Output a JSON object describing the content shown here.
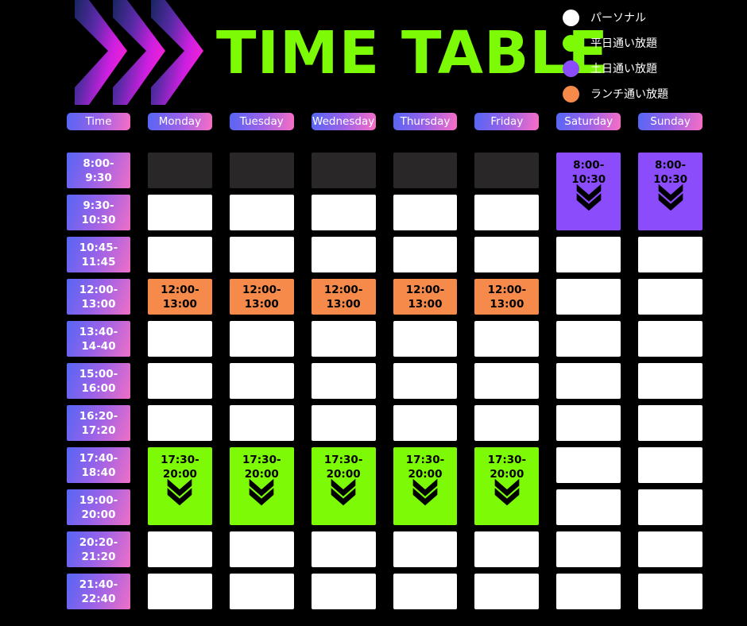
{
  "page": {
    "title": "TIME TABLE",
    "background_color": "#000000",
    "title_color": "#7DFB06"
  },
  "logo": {
    "icon": "triple-chevron-right-icon",
    "gradient_from": "#1b2a6e",
    "gradient_to": "#e81ee8"
  },
  "legend": {
    "items": [
      {
        "label": "パーソナル",
        "color": "#FFFFFF",
        "icon": "legend-dot-icon"
      },
      {
        "label": "平日通い放題",
        "color": "#7DFB06",
        "icon": "legend-dot-icon"
      },
      {
        "label": "土日通い放題",
        "color": "#8B4DFB",
        "icon": "legend-dot-icon"
      },
      {
        "label": "ランチ通い放題",
        "color": "#F58A4B",
        "icon": "legend-dot-icon"
      }
    ]
  },
  "table": {
    "headers": [
      "Time",
      "Monday",
      "Tuesday",
      "Wednesday",
      "Thursday",
      "Friday",
      "Saturday",
      "Sunday"
    ],
    "time_slots": [
      "8:00-\n9:30",
      "9:30-\n10:30",
      "10:45-\n11:45",
      "12:00-\n13:00",
      "13:40-\n14-40",
      "15:00-\n16:00",
      "16:20-\n17:20",
      "17:40-\n18:40",
      "19:00-\n20:00",
      "20:20-\n21:20",
      "21:40-\n22:40"
    ],
    "rows": [
      {
        "time": "8:00-\n9:30",
        "cells": [
          {
            "type": "dark",
            "text": ""
          },
          {
            "type": "dark",
            "text": ""
          },
          {
            "type": "dark",
            "text": ""
          },
          {
            "type": "dark",
            "text": ""
          },
          {
            "type": "dark",
            "text": ""
          },
          {
            "type": "purple",
            "text": "8:00-\n10:30",
            "span": "top"
          },
          {
            "type": "purple",
            "text": "8:00-\n10:30",
            "span": "top"
          }
        ]
      },
      {
        "time": "9:30-\n10:30",
        "cells": [
          {
            "type": "white",
            "text": ""
          },
          {
            "type": "white",
            "text": ""
          },
          {
            "type": "white",
            "text": ""
          },
          {
            "type": "white",
            "text": ""
          },
          {
            "type": "white",
            "text": ""
          },
          {
            "type": "purple",
            "text": "",
            "span": "bottom",
            "arrow": true
          },
          {
            "type": "purple",
            "text": "",
            "span": "bottom",
            "arrow": true
          }
        ]
      },
      {
        "time": "10:45-\n11:45",
        "cells": [
          {
            "type": "white",
            "text": ""
          },
          {
            "type": "white",
            "text": ""
          },
          {
            "type": "white",
            "text": ""
          },
          {
            "type": "white",
            "text": ""
          },
          {
            "type": "white",
            "text": ""
          },
          {
            "type": "white",
            "text": ""
          },
          {
            "type": "white",
            "text": ""
          }
        ]
      },
      {
        "time": "12:00-\n13:00",
        "cells": [
          {
            "type": "orange",
            "text": "12:00-\n13:00"
          },
          {
            "type": "orange",
            "text": "12:00-\n13:00"
          },
          {
            "type": "orange",
            "text": "12:00-\n13:00"
          },
          {
            "type": "orange",
            "text": "12:00-\n13:00"
          },
          {
            "type": "orange",
            "text": "12:00-\n13:00"
          },
          {
            "type": "white",
            "text": ""
          },
          {
            "type": "white",
            "text": ""
          }
        ]
      },
      {
        "time": "13:40-\n14-40",
        "cells": [
          {
            "type": "white",
            "text": ""
          },
          {
            "type": "white",
            "text": ""
          },
          {
            "type": "white",
            "text": ""
          },
          {
            "type": "white",
            "text": ""
          },
          {
            "type": "white",
            "text": ""
          },
          {
            "type": "white",
            "text": ""
          },
          {
            "type": "white",
            "text": ""
          }
        ]
      },
      {
        "time": "15:00-\n16:00",
        "cells": [
          {
            "type": "white",
            "text": ""
          },
          {
            "type": "white",
            "text": ""
          },
          {
            "type": "white",
            "text": ""
          },
          {
            "type": "white",
            "text": ""
          },
          {
            "type": "white",
            "text": ""
          },
          {
            "type": "white",
            "text": ""
          },
          {
            "type": "white",
            "text": ""
          }
        ]
      },
      {
        "time": "16:20-\n17:20",
        "cells": [
          {
            "type": "white",
            "text": ""
          },
          {
            "type": "white",
            "text": ""
          },
          {
            "type": "white",
            "text": ""
          },
          {
            "type": "white",
            "text": ""
          },
          {
            "type": "white",
            "text": ""
          },
          {
            "type": "white",
            "text": ""
          },
          {
            "type": "white",
            "text": ""
          }
        ]
      },
      {
        "time": "17:40-\n18:40",
        "cells": [
          {
            "type": "green",
            "text": "17:30-\n20:00",
            "span": "top"
          },
          {
            "type": "green",
            "text": "17:30-\n20:00",
            "span": "top"
          },
          {
            "type": "green",
            "text": "17:30-\n20:00",
            "span": "top"
          },
          {
            "type": "green",
            "text": "17:30-\n20:00",
            "span": "top"
          },
          {
            "type": "green",
            "text": "17:30-\n20:00",
            "span": "top"
          },
          {
            "type": "white",
            "text": ""
          },
          {
            "type": "white",
            "text": ""
          }
        ]
      },
      {
        "time": "19:00-\n20:00",
        "cells": [
          {
            "type": "green",
            "text": "",
            "span": "bottom",
            "arrow": true
          },
          {
            "type": "green",
            "text": "",
            "span": "bottom",
            "arrow": true
          },
          {
            "type": "green",
            "text": "",
            "span": "bottom",
            "arrow": true
          },
          {
            "type": "green",
            "text": "",
            "span": "bottom",
            "arrow": true
          },
          {
            "type": "green",
            "text": "",
            "span": "bottom",
            "arrow": true
          },
          {
            "type": "white",
            "text": ""
          },
          {
            "type": "white",
            "text": ""
          }
        ]
      },
      {
        "time": "20:20-\n21:20",
        "cells": [
          {
            "type": "white",
            "text": ""
          },
          {
            "type": "white",
            "text": ""
          },
          {
            "type": "white",
            "text": ""
          },
          {
            "type": "white",
            "text": ""
          },
          {
            "type": "white",
            "text": ""
          },
          {
            "type": "white",
            "text": ""
          },
          {
            "type": "white",
            "text": ""
          }
        ]
      },
      {
        "time": "21:40-\n22:40",
        "cells": [
          {
            "type": "white",
            "text": ""
          },
          {
            "type": "white",
            "text": ""
          },
          {
            "type": "white",
            "text": ""
          },
          {
            "type": "white",
            "text": ""
          },
          {
            "type": "white",
            "text": ""
          },
          {
            "type": "white",
            "text": ""
          },
          {
            "type": "white",
            "text": ""
          }
        ]
      }
    ]
  },
  "colors": {
    "green": "#7DFB06",
    "purple": "#8B4DFB",
    "orange": "#F58A4B",
    "white": "#FFFFFF",
    "dark": "#2A2729",
    "background": "#000000",
    "pill_gradient_start": "#5566F4",
    "pill_gradient_end": "#F96EC4"
  }
}
